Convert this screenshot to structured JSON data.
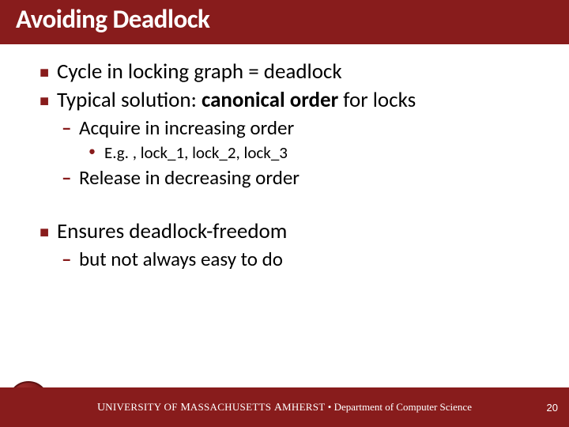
{
  "title": "Avoiding Deadlock",
  "bullets": {
    "b1a": "Cycle in locking graph = deadlock",
    "b1b_pre": "Typical solution: ",
    "b1b_bold": "canonical order",
    "b1b_post": " for locks",
    "b2a": "Acquire in increasing order",
    "b3a": "E.g. , lock_1, lock_2, lock_3",
    "b2b": "Release in decreasing order",
    "b1c": "Ensures deadlock-freedom",
    "b2c": "but not always easy to do"
  },
  "footer": {
    "univ_u": "U",
    "univ_rest": "NIVERSITY OF ",
    "mass_m": "M",
    "mass_rest": "ASSACHUSETTS ",
    "amh_a": "A",
    "amh_rest": "MHERST",
    "sep": "  •  ",
    "dept": "Department of Computer Science"
  },
  "page": "20"
}
